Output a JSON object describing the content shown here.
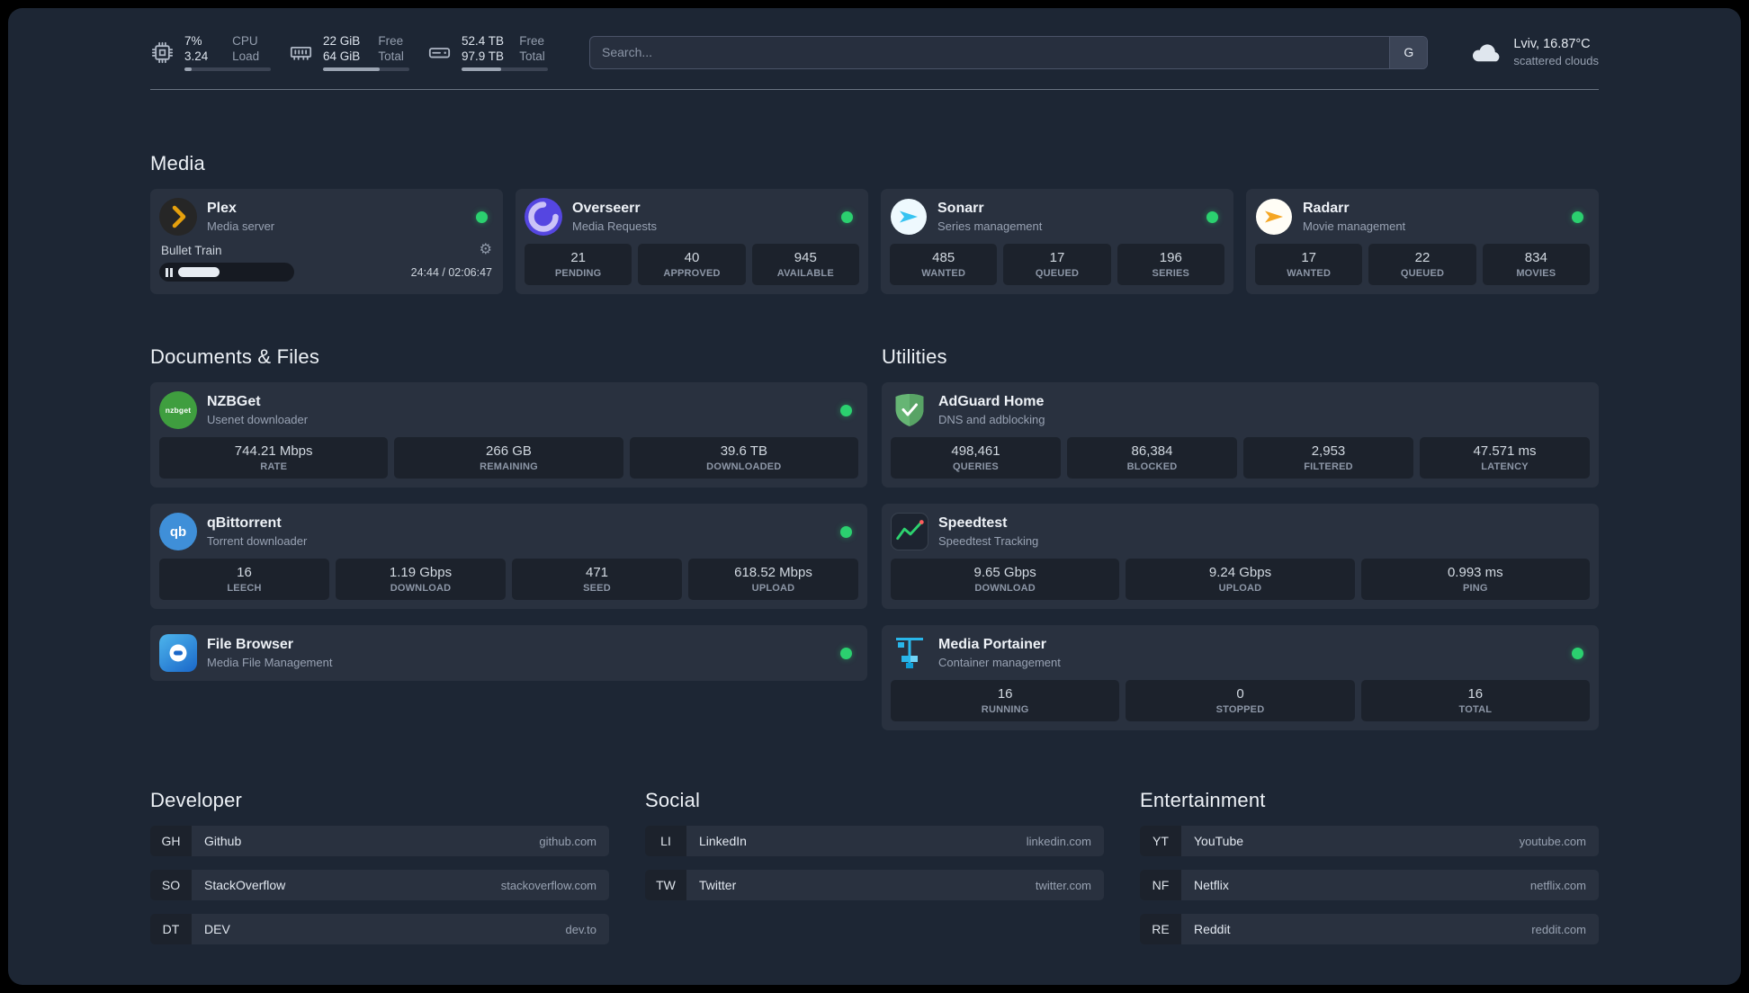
{
  "topbar": {
    "cpu": {
      "value1": "7%",
      "value2": "3.24",
      "label1": "CPU",
      "label2": "Load",
      "bar": "8%"
    },
    "memory": {
      "value1": "22 GiB",
      "value2": "64 GiB",
      "label1": "Free",
      "label2": "Total",
      "bar": "66%"
    },
    "disk": {
      "value1": "52.4 TB",
      "value2": "97.9 TB",
      "label1": "Free",
      "label2": "Total",
      "bar": "46%"
    },
    "search": {
      "placeholder": "Search...",
      "provider": "G"
    },
    "weather": {
      "location": "Lviv, 16.87°C",
      "condition": "scattered clouds"
    }
  },
  "media": {
    "section_title": "Media",
    "plex": {
      "title": "Plex",
      "subtitle": "Media server",
      "now_playing": "Bullet Train",
      "time": "24:44 / 02:06:47",
      "progress": "34%"
    },
    "overseerr": {
      "title": "Overseerr",
      "subtitle": "Media Requests",
      "stats": [
        {
          "value": "21",
          "label": "PENDING"
        },
        {
          "value": "40",
          "label": "APPROVED"
        },
        {
          "value": "945",
          "label": "AVAILABLE"
        }
      ]
    },
    "sonarr": {
      "title": "Sonarr",
      "subtitle": "Series management",
      "stats": [
        {
          "value": "485",
          "label": "WANTED"
        },
        {
          "value": "17",
          "label": "QUEUED"
        },
        {
          "value": "196",
          "label": "SERIES"
        }
      ]
    },
    "radarr": {
      "title": "Radarr",
      "subtitle": "Movie management",
      "stats": [
        {
          "value": "17",
          "label": "WANTED"
        },
        {
          "value": "22",
          "label": "QUEUED"
        },
        {
          "value": "834",
          "label": "MOVIES"
        }
      ]
    }
  },
  "documents": {
    "section_title": "Documents & Files",
    "nzbget": {
      "title": "NZBGet",
      "subtitle": "Usenet downloader",
      "icon_text": "nzbget",
      "stats": [
        {
          "value": "744.21 Mbps",
          "label": "RATE"
        },
        {
          "value": "266 GB",
          "label": "REMAINING"
        },
        {
          "value": "39.6 TB",
          "label": "DOWNLOADED"
        }
      ]
    },
    "qbittorrent": {
      "title": "qBittorrent",
      "subtitle": "Torrent downloader",
      "icon_text": "qb",
      "stats": [
        {
          "value": "16",
          "label": "LEECH"
        },
        {
          "value": "1.19 Gbps",
          "label": "DOWNLOAD"
        },
        {
          "value": "471",
          "label": "SEED"
        },
        {
          "value": "618.52 Mbps",
          "label": "UPLOAD"
        }
      ]
    },
    "filebrowser": {
      "title": "File Browser",
      "subtitle": "Media File Management"
    }
  },
  "utilities": {
    "section_title": "Utilities",
    "adguard": {
      "title": "AdGuard Home",
      "subtitle": "DNS and adblocking",
      "stats": [
        {
          "value": "498,461",
          "label": "QUERIES"
        },
        {
          "value": "86,384",
          "label": "BLOCKED"
        },
        {
          "value": "2,953",
          "label": "FILTERED"
        },
        {
          "value": "47.571 ms",
          "label": "LATENCY"
        }
      ]
    },
    "speedtest": {
      "title": "Speedtest",
      "subtitle": "Speedtest Tracking",
      "stats": [
        {
          "value": "9.65 Gbps",
          "label": "DOWNLOAD"
        },
        {
          "value": "9.24 Gbps",
          "label": "UPLOAD"
        },
        {
          "value": "0.993 ms",
          "label": "PING"
        }
      ]
    },
    "portainer": {
      "title": "Media Portainer",
      "subtitle": "Container management",
      "stats": [
        {
          "value": "16",
          "label": "RUNNING"
        },
        {
          "value": "0",
          "label": "STOPPED"
        },
        {
          "value": "16",
          "label": "TOTAL"
        }
      ]
    }
  },
  "bookmarks": {
    "groups": [
      {
        "title": "Developer",
        "items": [
          {
            "abbr": "GH",
            "name": "Github",
            "domain": "github.com"
          },
          {
            "abbr": "SO",
            "name": "StackOverflow",
            "domain": "stackoverflow.com"
          },
          {
            "abbr": "DT",
            "name": "DEV",
            "domain": "dev.to"
          }
        ]
      },
      {
        "title": "Social",
        "items": [
          {
            "abbr": "LI",
            "name": "LinkedIn",
            "domain": "linkedin.com"
          },
          {
            "abbr": "TW",
            "name": "Twitter",
            "domain": "twitter.com"
          }
        ]
      },
      {
        "title": "Entertainment",
        "items": [
          {
            "abbr": "YT",
            "name": "YouTube",
            "domain": "youtube.com"
          },
          {
            "abbr": "NF",
            "name": "Netflix",
            "domain": "netflix.com"
          },
          {
            "abbr": "RE",
            "name": "Reddit",
            "domain": "reddit.com"
          }
        ]
      }
    ]
  },
  "colors": {
    "status_dot": "#2bd06f",
    "background": "#1d2634",
    "card": "#293140"
  }
}
